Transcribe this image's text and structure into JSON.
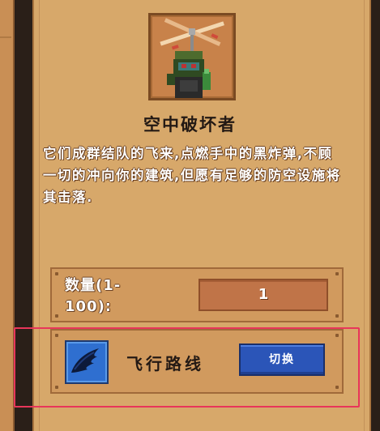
{
  "unit": {
    "portrait_icon": "air-bomber-portrait",
    "name": "空中破坏者",
    "description": "它们成群结队的飞来,点燃手中的黑炸弹,不顾一切的冲向你的建筑,但愿有足够的防空设施将其击落."
  },
  "quantity": {
    "label": "数量(1-100):",
    "value": "1"
  },
  "route": {
    "icon": "wing-icon",
    "label": "飞行路线",
    "switch_label": "切换"
  },
  "colors": {
    "panel": "#d7a86a",
    "highlight": "#e8365a",
    "button_blue": "#2b55b8"
  }
}
